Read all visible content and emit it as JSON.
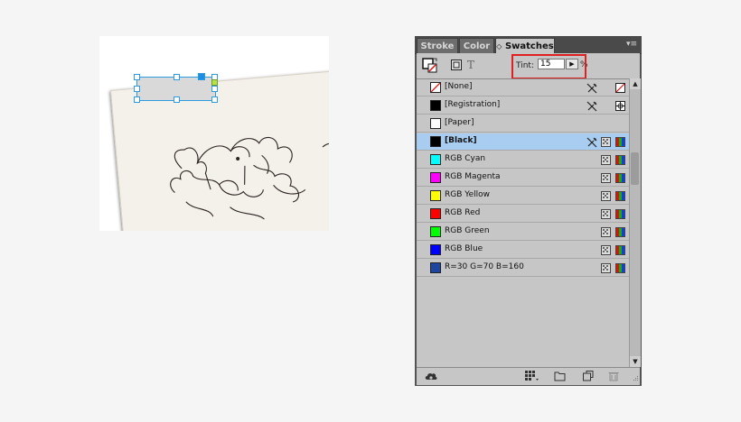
{
  "canvas": {
    "frame_fill": "#d9d9d9",
    "selection_color": "#2e9ae0"
  },
  "panel": {
    "tabs": [
      {
        "label": "Stroke"
      },
      {
        "label": "Color"
      },
      {
        "label": "Swatches",
        "active": true
      }
    ],
    "tabs_glyph": "◇",
    "menu_glyph": "▾≡",
    "toolbar": {
      "text_glyph": "T",
      "tint_label": "Tint:",
      "tint_value": "15",
      "tint_unit": "%",
      "tint_arrow": "▶"
    },
    "swatches": [
      {
        "name": "[None]",
        "color": "none",
        "icons": [
          "no-edit-icon",
          "none-swatch-icon"
        ]
      },
      {
        "name": "[Registration]",
        "color": "#000000",
        "icons": [
          "no-edit-icon",
          "registration-icon"
        ]
      },
      {
        "name": "[Paper]",
        "color": "#ffffff",
        "icons": []
      },
      {
        "name": "[Black]",
        "color": "#000000",
        "selected": true,
        "icons": [
          "no-edit-icon",
          "process-icon",
          "cmyk-icon"
        ]
      },
      {
        "name": "RGB Cyan",
        "color": "#00ffff",
        "icons": [
          "process-icon",
          "rgb-icon"
        ]
      },
      {
        "name": "RGB Magenta",
        "color": "#ff00ff",
        "icons": [
          "process-icon",
          "rgb-icon"
        ]
      },
      {
        "name": "RGB Yellow",
        "color": "#ffff00",
        "icons": [
          "process-icon",
          "rgb-icon"
        ]
      },
      {
        "name": "RGB Red",
        "color": "#ff0000",
        "icons": [
          "process-icon",
          "rgb-icon"
        ]
      },
      {
        "name": "RGB Green",
        "color": "#00ff00",
        "icons": [
          "process-icon",
          "rgb-icon"
        ]
      },
      {
        "name": "RGB Blue",
        "color": "#0000ff",
        "icons": [
          "process-icon",
          "rgb-icon"
        ]
      },
      {
        "name": "R=30 G=70 B=160",
        "color": "#1e46a0",
        "icons": [
          "process-icon",
          "rgb-icon"
        ]
      }
    ],
    "scroll": {
      "up": "▲",
      "down": "▼"
    },
    "bottom_icons": [
      "cc-libraries-icon",
      "swatch-views-icon",
      "new-color-group-icon",
      "new-swatch-icon",
      "delete-swatch-icon"
    ],
    "highlight_color": "#e02020"
  }
}
